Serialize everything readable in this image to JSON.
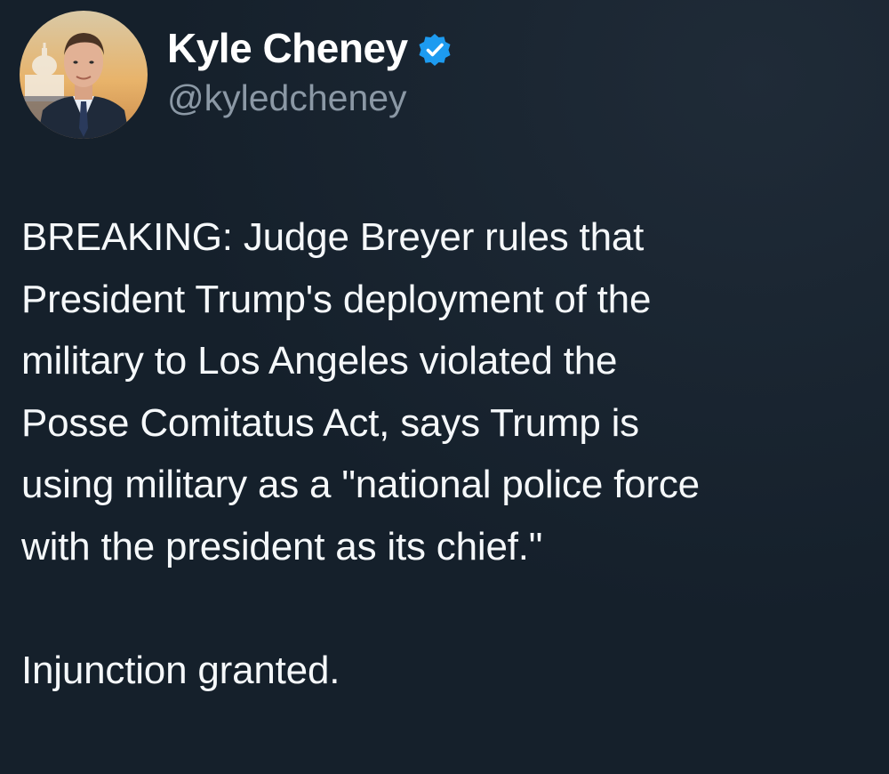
{
  "author": {
    "display_name": "Kyle Cheney",
    "handle": "@kyledcheney",
    "verified": true,
    "avatar_icon": "profile-photo-icon"
  },
  "tweet": {
    "text_line_1": "BREAKING: Judge Breyer rules that",
    "text_line_2": "President Trump's deployment of the",
    "text_line_3": "military to Los Angeles violated the",
    "text_line_4": "Posse Comitatus Act, says Trump is",
    "text_line_5": "using military as a \"national police force",
    "text_line_6": "with the president as its chief.\"",
    "text_line_8": "Injunction granted."
  },
  "colors": {
    "background": "#15202b",
    "verified_badge": "#1d9bf0",
    "handle": "#8b98a5",
    "text": "#f5f8fa"
  }
}
